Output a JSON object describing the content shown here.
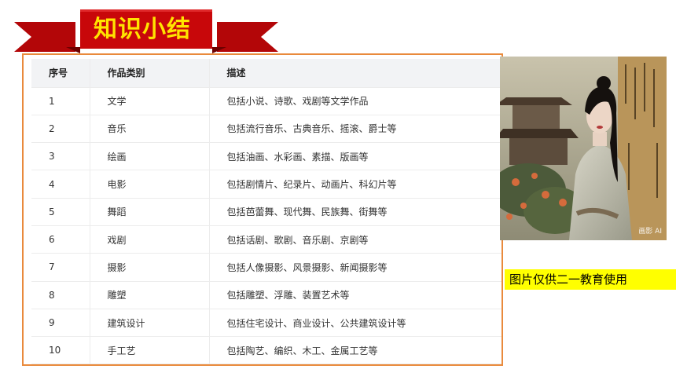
{
  "banner": {
    "title": "知识小结",
    "colors": {
      "ribbon": "#c8070a",
      "title": "#ffe400"
    }
  },
  "table": {
    "headers": [
      "序号",
      "作品类别",
      "描述"
    ],
    "rows": [
      [
        "1",
        "文学",
        "包括小说、诗歌、戏剧等文学作品"
      ],
      [
        "2",
        "音乐",
        "包括流行音乐、古典音乐、摇滚、爵士等"
      ],
      [
        "3",
        "绘画",
        "包括油画、水彩画、素描、版画等"
      ],
      [
        "4",
        "电影",
        "包括剧情片、纪录片、动画片、科幻片等"
      ],
      [
        "5",
        "舞蹈",
        "包括芭蕾舞、现代舞、民族舞、街舞等"
      ],
      [
        "6",
        "戏剧",
        "包括话剧、歌剧、音乐剧、京剧等"
      ],
      [
        "7",
        "摄影",
        "包括人像摄影、风景摄影、新闻摄影等"
      ],
      [
        "8",
        "雕塑",
        "包括雕塑、浮雕、装置艺术等"
      ],
      [
        "9",
        "建筑设计",
        "包括住宅设计、商业设计、公共建筑设计等"
      ],
      [
        "10",
        "手工艺",
        "包括陶艺、编织、木工、金属工艺等"
      ]
    ],
    "border_color": "#e98a3c"
  },
  "photo": {
    "subject": "woman-in-traditional-hanfu-with-pavilion-illustration",
    "watermark": "画影 AI"
  },
  "caption": {
    "text": "图片仅供二一教育使用",
    "background": "#ffff00"
  }
}
